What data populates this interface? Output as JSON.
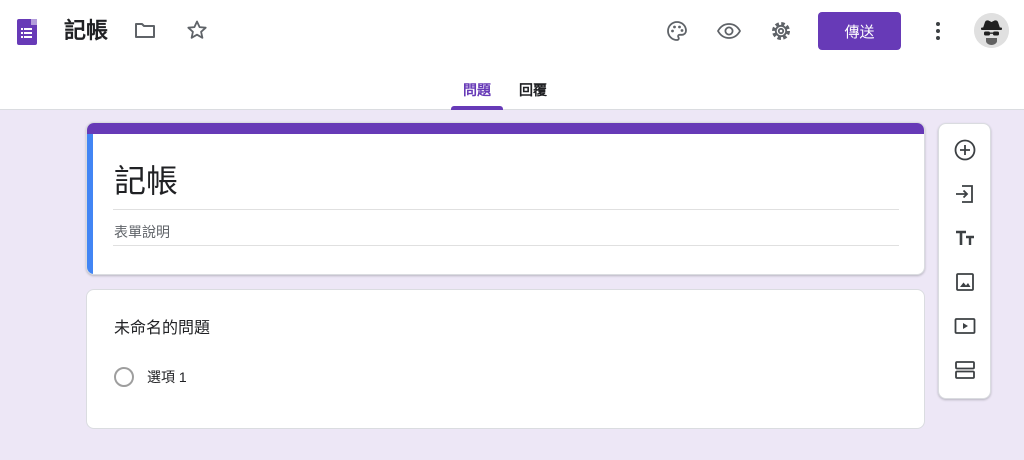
{
  "header": {
    "title": "記帳",
    "send_label": "傳送"
  },
  "tabs": [
    {
      "label": "問題",
      "active": true
    },
    {
      "label": "回覆",
      "active": false
    }
  ],
  "form": {
    "title": "記帳",
    "description_placeholder": "表單說明"
  },
  "question": {
    "title": "未命名的問題",
    "options": [
      {
        "label": "選項 1"
      }
    ]
  },
  "side_toolbar": {
    "tools": [
      "add-question-icon",
      "import-questions-icon",
      "add-title-icon",
      "add-image-icon",
      "add-video-icon",
      "add-section-icon"
    ]
  },
  "colors": {
    "accent": "#673ab7",
    "background": "#ede7f6",
    "header_left_accent": "#4285f4"
  }
}
